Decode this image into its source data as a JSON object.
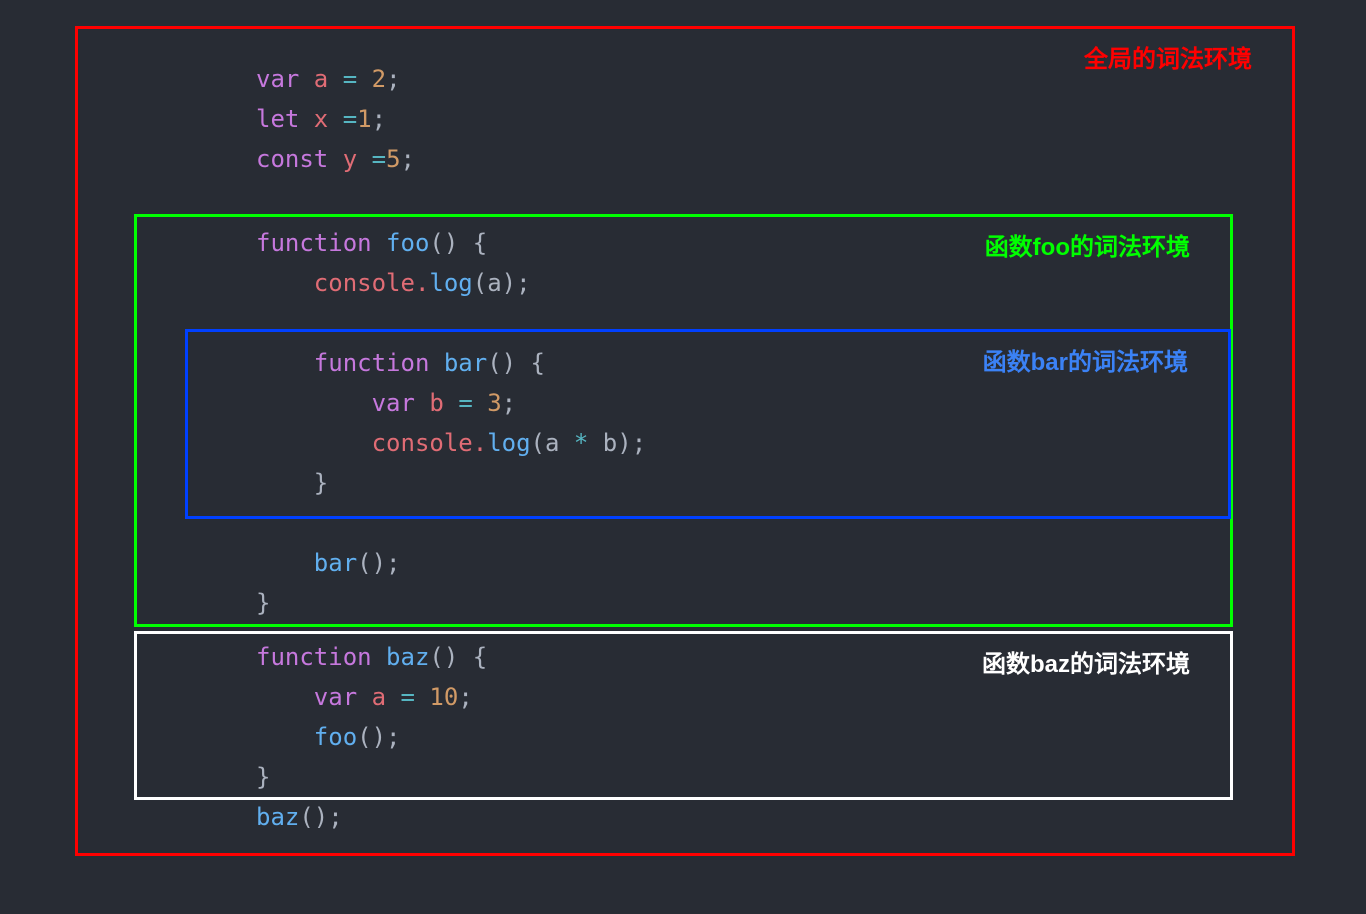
{
  "labels": {
    "global": "全局的词法环境",
    "foo": "函数foo的词法环境",
    "bar": "函数bar的词法环境",
    "baz": "函数baz的词法环境"
  },
  "code": {
    "line1_var": "var",
    "line1_id": " a ",
    "line1_eq": "=",
    "line1_num": " 2",
    "line1_semi": ";",
    "line2_let": "let",
    "line2_id": " x ",
    "line2_eq": "=",
    "line2_num": "1",
    "line2_semi": ";",
    "line3_const": "const",
    "line3_id": " y ",
    "line3_eq": "=",
    "line3_num": "5",
    "line3_semi": ";",
    "foo_fn": "function",
    "foo_name": " foo",
    "foo_paren": "() {",
    "foo_console": "    console.",
    "foo_log": "log",
    "foo_arg": "(a);",
    "bar_fn": "    function",
    "bar_name": " bar",
    "bar_paren": "() {",
    "bar_var": "        var",
    "bar_id": " b ",
    "bar_eq": "=",
    "bar_num": " 3",
    "bar_semi": ";",
    "bar_console": "        console.",
    "bar_log": "log",
    "bar_arg_open": "(a ",
    "bar_mul": "*",
    "bar_arg_close": " b);",
    "bar_close": "    }",
    "foo_call_bar": "    bar",
    "foo_call_paren": "();",
    "foo_close": "}",
    "baz_fn": "function",
    "baz_name": " baz",
    "baz_paren": "() {",
    "baz_var": "    var",
    "baz_id": " a ",
    "baz_eq": "=",
    "baz_num": " 10",
    "baz_semi": ";",
    "baz_call_foo": "    foo",
    "baz_call_paren": "();",
    "baz_close": "}",
    "call_baz": "baz",
    "call_baz_paren": "();"
  },
  "colors": {
    "global_border": "#ff0000",
    "foo_border": "#00ff00",
    "bar_border": "#0040ff",
    "baz_border": "#ffffff",
    "bg": "#282c34"
  }
}
